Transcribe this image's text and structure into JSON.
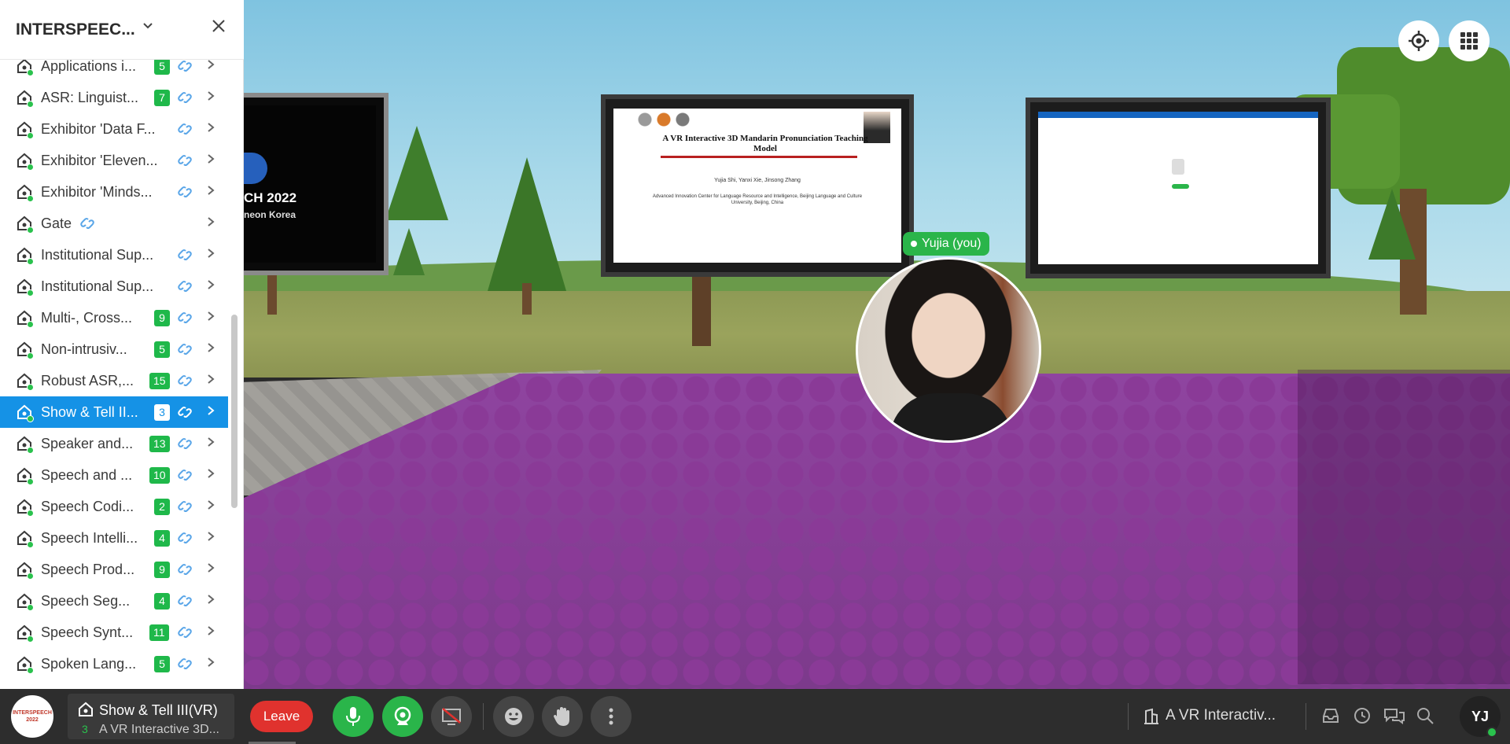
{
  "sidebar": {
    "title": "INTERSPEEC...",
    "items": [
      {
        "label": "Applications i...",
        "count": "5",
        "active": false
      },
      {
        "label": "ASR: Linguist...",
        "count": "7",
        "active": false
      },
      {
        "label": "Exhibitor 'Data F...",
        "count": "",
        "active": false
      },
      {
        "label": "Exhibitor 'Eleven...",
        "count": "",
        "active": false
      },
      {
        "label": "Exhibitor 'Minds...",
        "count": "",
        "active": false
      },
      {
        "label": "Gate",
        "count": "",
        "active": false
      },
      {
        "label": "Institutional Sup...",
        "count": "",
        "active": false
      },
      {
        "label": "Institutional Sup...",
        "count": "",
        "active": false
      },
      {
        "label": "Multi-, Cross...",
        "count": "9",
        "active": false
      },
      {
        "label": "Non-intrusiv...",
        "count": "5",
        "active": false
      },
      {
        "label": "Robust ASR,...",
        "count": "15",
        "active": false
      },
      {
        "label": "Show & Tell II...",
        "count": "3",
        "active": true
      },
      {
        "label": "Speaker and...",
        "count": "13",
        "active": false
      },
      {
        "label": "Speech and ...",
        "count": "10",
        "active": false
      },
      {
        "label": "Speech Codi...",
        "count": "2",
        "active": false
      },
      {
        "label": "Speech Intelli...",
        "count": "4",
        "active": false
      },
      {
        "label": "Speech Prod...",
        "count": "9",
        "active": false
      },
      {
        "label": "Speech Seg...",
        "count": "4",
        "active": false
      },
      {
        "label": "Speech Synt...",
        "count": "11",
        "active": false
      },
      {
        "label": "Spoken Lang...",
        "count": "5",
        "active": false
      }
    ]
  },
  "scene": {
    "left_screen_title": "CH 2022",
    "left_screen_sub": "neon Korea",
    "slide_title": "A VR Interactive 3D Mandarin Pronunciation Teaching Model",
    "slide_authors": "Yujia Shi, Yanxi Xie, Jinsong Zhang",
    "slide_affil": "Advanced Innovation Center for Language Resource and Intelligence, Beijing Language and Culture University, Beijing, China",
    "avatar_label": "Yujia (you)"
  },
  "bottombar": {
    "room_name": "Show & Tell III(VR)",
    "room_sub": "A VR Interactive 3D...",
    "room_count": "3",
    "leave_label": "Leave",
    "share_label": "A VR Interactiv...",
    "user_initials": "YJ",
    "logo_text": "INTERSPEECH 2022"
  },
  "colors": {
    "accent": "#1592e6",
    "green": "#2ab54a",
    "leave": "#e0322e",
    "floor": "#8f44a0"
  }
}
